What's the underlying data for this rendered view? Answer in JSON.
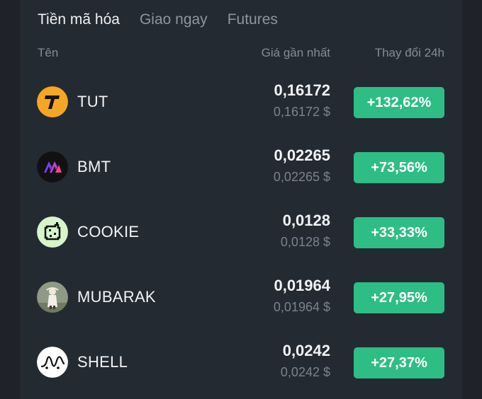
{
  "tabs": [
    {
      "label": "Tiền mã hóa",
      "active": true
    },
    {
      "label": "Giao ngay",
      "active": false
    },
    {
      "label": "Futures",
      "active": false
    }
  ],
  "columns": {
    "name": "Tên",
    "last_price": "Giá gần nhất",
    "change_24h": "Thay đổi 24h"
  },
  "colors": {
    "background": "#1f2329",
    "panel": "#242a32",
    "positive": "#2ebd85",
    "text_primary": "#f1f3f5",
    "text_muted": "#7c838d"
  },
  "coins": [
    {
      "symbol": "TUT",
      "price": "0,16172",
      "price_usd": "0,16172 $",
      "change": "+132,62%",
      "icon": "tut-icon"
    },
    {
      "symbol": "BMT",
      "price": "0,02265",
      "price_usd": "0,02265 $",
      "change": "+73,56%",
      "icon": "bmt-icon"
    },
    {
      "symbol": "COOKIE",
      "price": "0,0128",
      "price_usd": "0,0128 $",
      "change": "+33,33%",
      "icon": "cookie-icon"
    },
    {
      "symbol": "MUBARAK",
      "price": "0,01964",
      "price_usd": "0,01964 $",
      "change": "+27,95%",
      "icon": "mubarak-icon"
    },
    {
      "symbol": "SHELL",
      "price": "0,0242",
      "price_usd": "0,0242 $",
      "change": "+27,37%",
      "icon": "shell-icon"
    }
  ]
}
